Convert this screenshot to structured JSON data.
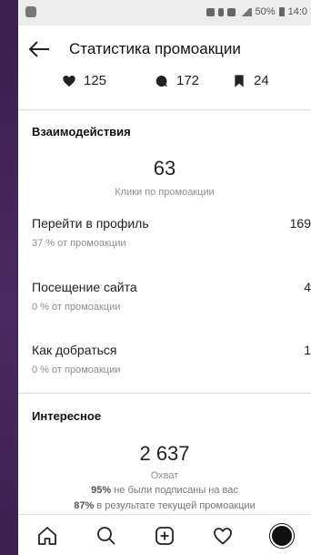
{
  "status_bar": {
    "battery": "50%",
    "time": "14:0"
  },
  "header": {
    "title": "Статистика промоакции"
  },
  "counts": {
    "likes": "125",
    "comments": "172",
    "saves": "24"
  },
  "interactions": {
    "title": "Взаимодействия",
    "clicks_value": "63",
    "clicks_label": "Клики по промоакции",
    "rows": [
      {
        "label": "Перейти в профиль",
        "sub": "37 % от промоакции",
        "value": "169"
      },
      {
        "label": "Посещение сайта",
        "sub": "0 % от промоакции",
        "value": "4"
      },
      {
        "label": "Как добраться",
        "sub": "0 % от промоакции",
        "value": "1"
      }
    ]
  },
  "interesting": {
    "title": "Интересное",
    "reach_value": "2 637",
    "reach_label": "Охват",
    "line1_bold": "95%",
    "line1_rest": " не были подписаны на вас",
    "line2_bold": "87%",
    "line2_rest": " в результате текущей промоакции"
  },
  "bottom_nav": [
    "home-icon",
    "search-icon",
    "add-post-icon",
    "activity-heart-icon",
    "profile-avatar"
  ]
}
